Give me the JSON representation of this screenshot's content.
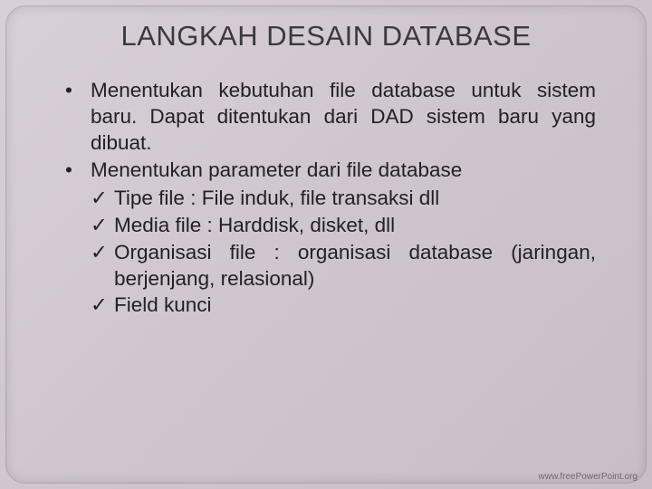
{
  "title": "LANGKAH DESAIN DATABASE",
  "bullets": [
    {
      "text": "Menentukan kebutuhan file database untuk sistem baru. Dapat ditentukan dari DAD sistem baru yang dibuat."
    },
    {
      "text": "Menentukan parameter dari file database"
    }
  ],
  "checks": [
    {
      "text": "Tipe file : File induk, file transaksi dll"
    },
    {
      "text": "Media file : Harddisk, disket, dll"
    },
    {
      "text": "Organisasi file : organisasi database (jaringan, berjenjang, relasional)"
    },
    {
      "text": "Field kunci"
    }
  ],
  "footer": "www.freePowerPoint.org"
}
